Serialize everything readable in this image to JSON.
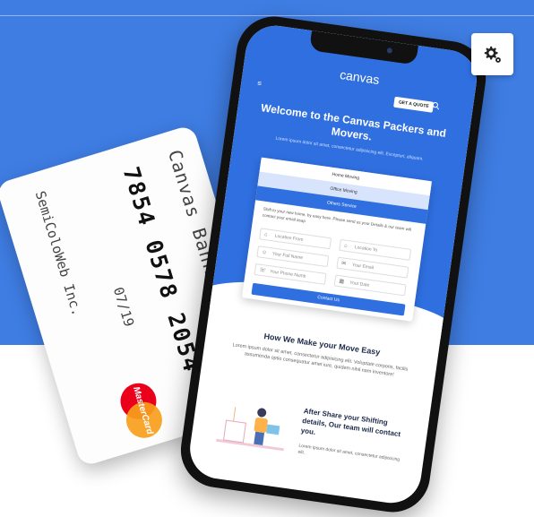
{
  "settings": {
    "icon": "gear-icon"
  },
  "card": {
    "bank": "Canvas Bank",
    "number": "7854 0578 2054 3281",
    "holder": "SemiColoWeb Inc.",
    "expiry": "07/19",
    "brand_label": "MasterCard"
  },
  "phone": {
    "logo": "canvas",
    "menu_icon": "≡",
    "quote_button": "GET A QUOTE",
    "hero_title": "Welcome to the Canvas Packers and Movers.",
    "hero_subtitle": "Lorem ipsum dolor sit amet, consectetur adipisicing elit. Excepturi, aliquam.",
    "tabs": [
      "Home Moving",
      "Office Moving",
      "Others Service"
    ],
    "form_text": "Shift to your new home, by easy here. Please send us your Details & our team will contact your email asap",
    "fields": [
      {
        "placeholder": "Location From"
      },
      {
        "placeholder": "Location To"
      },
      {
        "placeholder": "Your Full Name"
      },
      {
        "placeholder": "Your Email"
      },
      {
        "placeholder": "Your Phone Numb"
      },
      {
        "placeholder": "Your Date"
      }
    ],
    "submit": "Contact Us",
    "section_title": "How We Make your Move Easy",
    "section_text": "Lorem ipsum dolor sit amet, consectetur adipisicing elit. Voluptate corporis, facilis assumenda optio consequatur amet iure, quidem nihil nam inventore!",
    "step_title": "After Share your Shifting details, Our team will contact you.",
    "step_text": "Lorem ipsum dolor sit amet, consectetur adipisicing elit."
  },
  "colors": {
    "hero_blue": "#3f7de3",
    "phone_blue": "#2f6fe0",
    "mastercard_red": "#eb001b",
    "mastercard_orange": "#f79e1b"
  }
}
